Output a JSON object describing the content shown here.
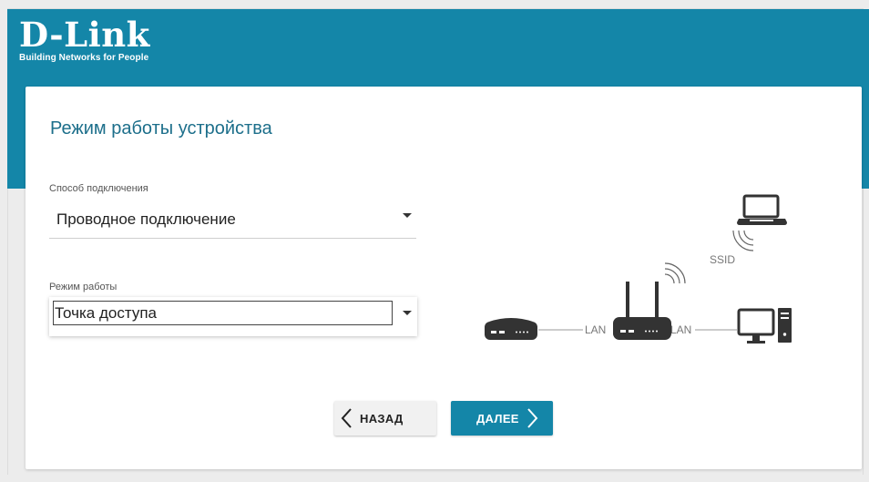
{
  "brand": {
    "logo_text": "D-Link",
    "tagline": "Building Networks for People"
  },
  "page": {
    "title": "Режим работы устройства"
  },
  "connection": {
    "label": "Способ подключения",
    "value": "Проводное подключение"
  },
  "mode": {
    "label": "Режим работы",
    "value": "Точка доступа"
  },
  "buttons": {
    "back_label": "НАЗАД",
    "next_label": "ДАЛЕЕ"
  },
  "diagram": {
    "ssid_label": "SSID",
    "lan_left": "LAN",
    "lan_right": "LAN",
    "devices": [
      "modem-icon",
      "router-icon",
      "laptop-icon",
      "desktop-pc-icon"
    ]
  },
  "colors": {
    "brand": "#1486a8",
    "title": "#1d6f8b",
    "background": "#ececec"
  }
}
